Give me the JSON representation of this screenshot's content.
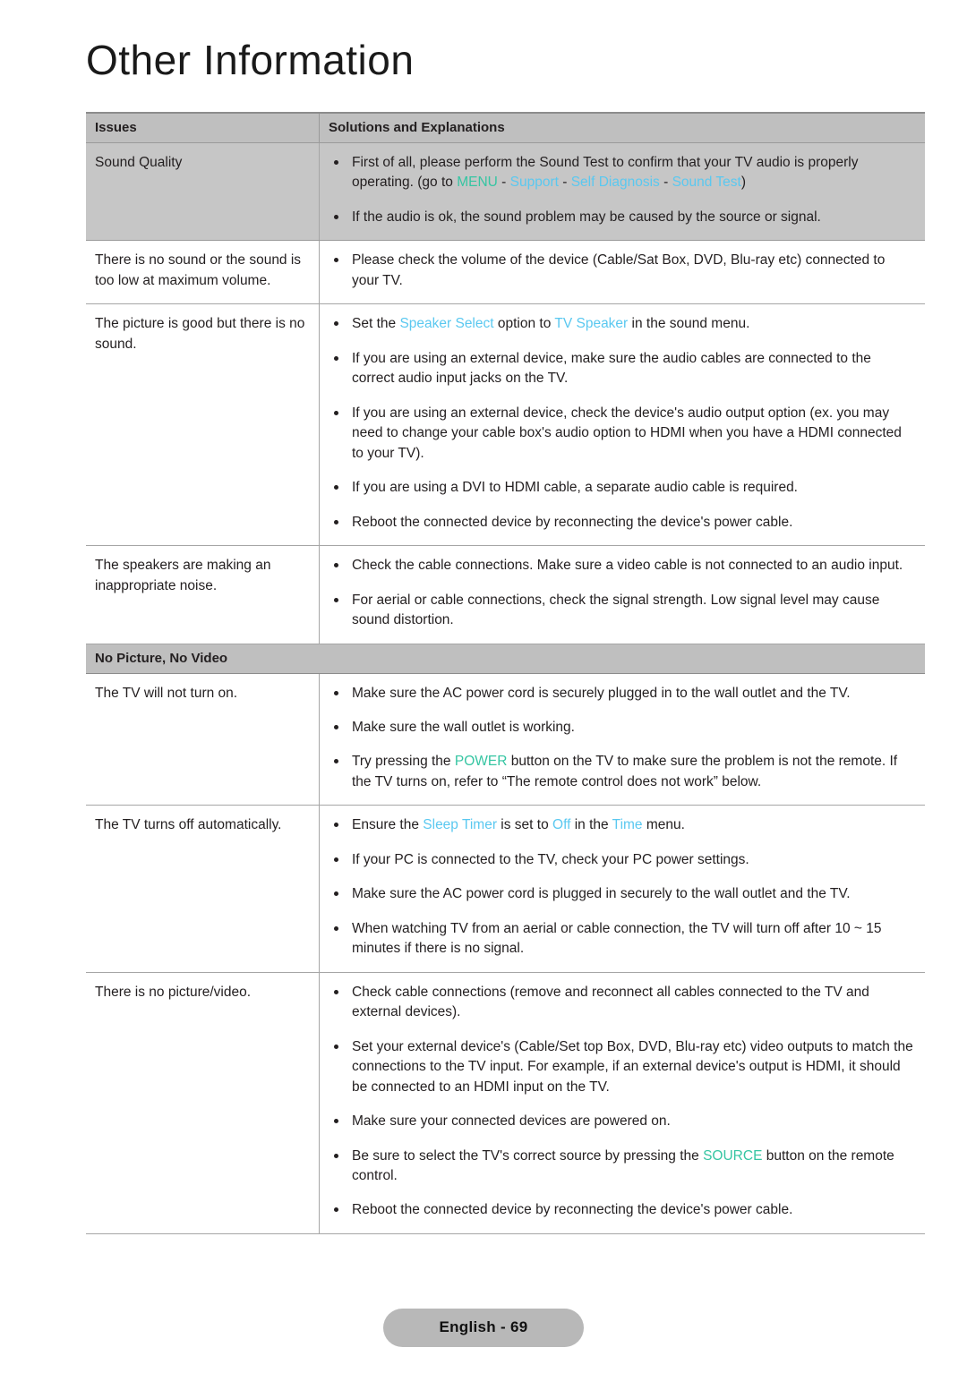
{
  "page": {
    "chapter_title": "Other Information",
    "footer_label": "English - 69"
  },
  "colors": {
    "keyword_green": "#35c5a2",
    "keyword_blue": "#5ac8f0",
    "header_bg": "#bfbfbf",
    "shaded_row_bg": "#c6c6c6",
    "text": "#231f20"
  },
  "table": {
    "headers": {
      "issues": "Issues",
      "solutions": "Solutions and Explanations"
    },
    "rows": [
      {
        "type": "body",
        "shaded": true,
        "issue": "Sound Quality",
        "bullets": [
          {
            "parts": [
              {
                "t": "First of all, please perform the Sound Test to confirm that your TV audio is properly operating. (go to ",
                "c": "plain"
              },
              {
                "t": "MENU",
                "c": "green"
              },
              {
                "t": " - ",
                "c": "plain"
              },
              {
                "t": "Support",
                "c": "blue"
              },
              {
                "t": " - ",
                "c": "plain"
              },
              {
                "t": "Self Diagnosis",
                "c": "blue"
              },
              {
                "t": " - ",
                "c": "plain"
              },
              {
                "t": "Sound Test",
                "c": "blue"
              },
              {
                "t": ")",
                "c": "plain"
              }
            ]
          },
          {
            "parts": [
              {
                "t": "If the audio is ok, the sound problem may be caused by the source or signal.",
                "c": "plain"
              }
            ]
          }
        ]
      },
      {
        "type": "body",
        "shaded": false,
        "issue": "There is no sound or the sound is too low at maximum volume.",
        "bullets": [
          {
            "parts": [
              {
                "t": "Please check the volume of the device (Cable/Sat Box, DVD, Blu-ray etc) connected to your TV.",
                "c": "plain"
              }
            ]
          }
        ]
      },
      {
        "type": "body",
        "shaded": false,
        "issue": "The picture is good but there is no sound.",
        "bullets": [
          {
            "parts": [
              {
                "t": "Set the ",
                "c": "plain"
              },
              {
                "t": "Speaker Select",
                "c": "blue"
              },
              {
                "t": " option to ",
                "c": "plain"
              },
              {
                "t": "TV Speaker",
                "c": "blue"
              },
              {
                "t": " in the sound menu.",
                "c": "plain"
              }
            ]
          },
          {
            "parts": [
              {
                "t": "If you are using an external device, make sure the audio cables are connected to the correct audio input jacks on the TV.",
                "c": "plain"
              }
            ]
          },
          {
            "parts": [
              {
                "t": "If you are using an external device, check the device's audio output option (ex. you may need to change your cable box's audio option to HDMI when you have a HDMI connected to your TV).",
                "c": "plain"
              }
            ]
          },
          {
            "parts": [
              {
                "t": "If you are using a DVI to HDMI cable, a separate audio cable is required.",
                "c": "plain"
              }
            ]
          },
          {
            "parts": [
              {
                "t": "Reboot the connected device by reconnecting the device's power cable.",
                "c": "plain"
              }
            ]
          }
        ]
      },
      {
        "type": "body",
        "shaded": false,
        "issue": "The speakers are making an inappropriate noise.",
        "bullets": [
          {
            "parts": [
              {
                "t": "Check the cable connections. Make sure a video cable is not connected to an audio input.",
                "c": "plain"
              }
            ]
          },
          {
            "parts": [
              {
                "t": "For aerial or cable connections, check the signal strength. Low signal level may cause sound distortion.",
                "c": "plain"
              }
            ]
          }
        ]
      },
      {
        "type": "section",
        "title": "No Picture, No Video"
      },
      {
        "type": "body",
        "shaded": false,
        "issue": "The TV will not turn on.",
        "bullets": [
          {
            "parts": [
              {
                "t": "Make sure the AC power cord is securely plugged in to the wall outlet and the TV.",
                "c": "plain"
              }
            ]
          },
          {
            "parts": [
              {
                "t": "Make sure the wall outlet is working.",
                "c": "plain"
              }
            ]
          },
          {
            "parts": [
              {
                "t": "Try pressing the ",
                "c": "plain"
              },
              {
                "t": "POWER",
                "c": "green"
              },
              {
                "t": " button on the TV to make sure the problem is not the remote. If the TV turns on, refer to “The remote control does not work” below.",
                "c": "plain"
              }
            ]
          }
        ]
      },
      {
        "type": "body",
        "shaded": false,
        "issue": "The TV turns off automatically.",
        "bullets": [
          {
            "parts": [
              {
                "t": "Ensure the ",
                "c": "plain"
              },
              {
                "t": "Sleep Timer",
                "c": "blue"
              },
              {
                "t": " is set to ",
                "c": "plain"
              },
              {
                "t": "Off",
                "c": "blue"
              },
              {
                "t": " in the ",
                "c": "plain"
              },
              {
                "t": "Time",
                "c": "blue"
              },
              {
                "t": " menu.",
                "c": "plain"
              }
            ]
          },
          {
            "parts": [
              {
                "t": "If your PC is connected to the TV, check your PC power settings.",
                "c": "plain"
              }
            ]
          },
          {
            "parts": [
              {
                "t": "Make sure the AC power cord is plugged in securely to the wall outlet and the TV.",
                "c": "plain"
              }
            ]
          },
          {
            "parts": [
              {
                "t": "When watching TV from an aerial or cable connection, the TV will turn off after 10 ~ 15 minutes if there is no signal.",
                "c": "plain"
              }
            ]
          }
        ]
      },
      {
        "type": "body",
        "shaded": false,
        "issue": "There is no picture/video.",
        "bullets": [
          {
            "parts": [
              {
                "t": "Check cable connections (remove and reconnect all cables connected to the TV and external devices).",
                "c": "plain"
              }
            ]
          },
          {
            "parts": [
              {
                "t": "Set your external device's (Cable/Set top Box, DVD, Blu-ray etc) video outputs to match the connections to the TV input. For example, if an external device's output is HDMI, it should be connected to an HDMI input on the TV.",
                "c": "plain"
              }
            ]
          },
          {
            "parts": [
              {
                "t": "Make sure your connected devices are powered on.",
                "c": "plain"
              }
            ]
          },
          {
            "parts": [
              {
                "t": "Be sure to select the TV's correct source by pressing the ",
                "c": "plain"
              },
              {
                "t": "SOURCE",
                "c": "green"
              },
              {
                "t": " button on the remote control.",
                "c": "plain"
              }
            ]
          },
          {
            "parts": [
              {
                "t": "Reboot the connected device by reconnecting the device's power cable.",
                "c": "plain"
              }
            ]
          }
        ]
      }
    ]
  }
}
